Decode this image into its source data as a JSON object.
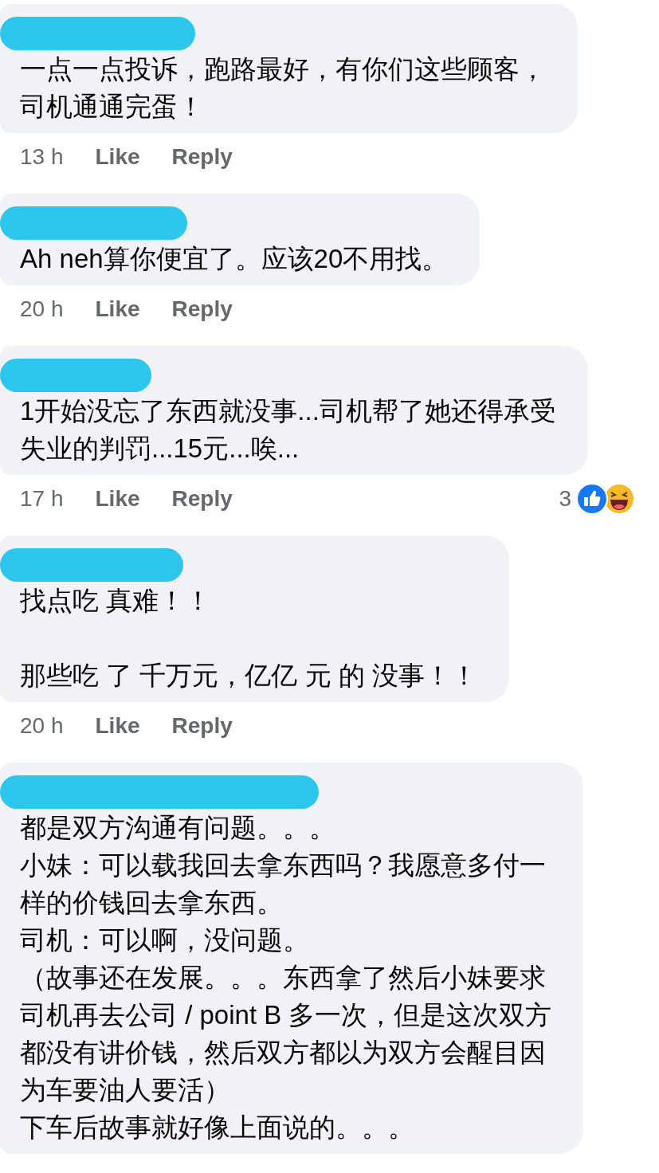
{
  "comments": [
    {
      "paragraphs": [
        [
          "一点一点投诉，跑路最好，有你们这些顾客，",
          "司机通通完蛋！"
        ]
      ],
      "time": "13 h",
      "like": "Like",
      "reply": "Reply"
    },
    {
      "paragraphs": [
        [
          "Ah neh算你便宜了。应该20不用找。"
        ]
      ],
      "time": "20 h",
      "like": "Like",
      "reply": "Reply"
    },
    {
      "paragraphs": [
        [
          "1开始没忘了东西就没事...司机帮了她还得承受",
          "失业的判罚...15元...唉..."
        ]
      ],
      "time": "17 h",
      "like": "Like",
      "reply": "Reply",
      "reactions": {
        "count": "3",
        "icons": [
          {
            "kind": "like"
          },
          {
            "kind": "haha"
          }
        ]
      }
    },
    {
      "paragraphs": [
        [
          "找点吃 真难！！"
        ],
        [
          "那些吃 了 千万元，亿亿 元 的 没事！！"
        ]
      ],
      "time": "20 h",
      "like": "Like",
      "reply": "Reply"
    },
    {
      "paragraphs": [
        [
          "都是双方沟通有问题。。。",
          "小妹：可以载我回去拿东西吗？我愿意多付一",
          "样的价钱回去拿东西。",
          "司机：可以啊，没问题。",
          "（故事还在发展。。。东西拿了然后小妹要求",
          "司机再去公司 / point B 多一次，但是这次双方",
          "都没有讲价钱，然后双方都以为双方会醒目因",
          "为车要油人要活）",
          "下车后故事就好像上面说的。。。"
        ]
      ]
    }
  ]
}
